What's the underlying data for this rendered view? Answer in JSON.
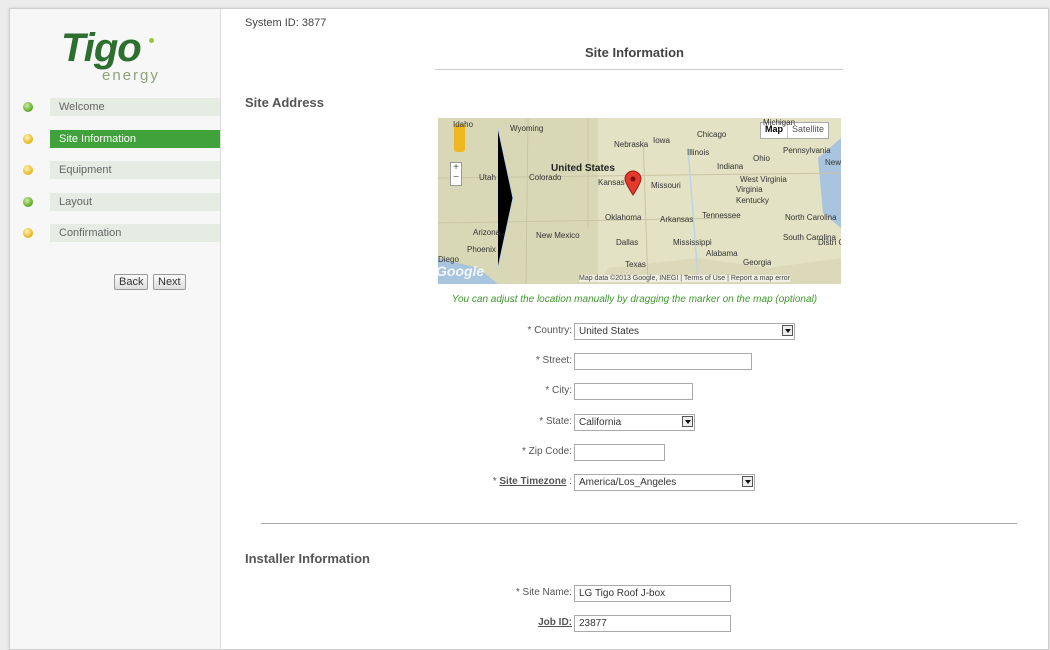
{
  "logo": {
    "brand": "Tigo",
    "sub": "energy"
  },
  "steps": [
    {
      "label": "Welcome",
      "status": "done"
    },
    {
      "label": "Site Information",
      "status": "current"
    },
    {
      "label": "Equipment",
      "status": "pending"
    },
    {
      "label": "Layout",
      "status": "done"
    },
    {
      "label": "Confirmation",
      "status": "pending"
    }
  ],
  "nav": {
    "back": "Back",
    "next": "Next"
  },
  "header": {
    "system_id": "System ID: 3877",
    "title": "Site Information"
  },
  "site_address": {
    "heading": "Site Address",
    "map": {
      "map_tab": "Map",
      "satellite_tab": "Satellite",
      "attribution": "Map data ©2013 Google, INEGI",
      "terms": "Terms of Use",
      "report": "Report a map error",
      "google": "Google",
      "zoom_in": "+",
      "zoom_out": "−",
      "places": [
        "Idaho",
        "Wyoming",
        "Nebraska",
        "Iowa",
        "Chicago",
        "Illinois",
        "Ohio",
        "Pennsylvania",
        "New",
        "Indiana",
        "United States",
        "Utah",
        "Colorado",
        "Kansas",
        "Missouri",
        "West Virginia",
        "Kentucky",
        "Virginia",
        "North Carolina",
        "Tennessee",
        "Oklahoma",
        "Arkansas",
        "Arizona",
        "New Mexico",
        "Dallas",
        "Mississippi",
        "South Carolina",
        "Alabama",
        "Georgia",
        "Texas",
        "Phoenix",
        "Diego",
        "Michigan",
        "Distri Colur"
      ],
      "marker_icon": "map-marker-icon"
    },
    "hint": "You can adjust the location manually by dragging the marker on the map (optional)",
    "country": {
      "label": "* Country:",
      "value": "United States"
    },
    "street": {
      "label": "* Street:",
      "value": ""
    },
    "city": {
      "label": "* City:",
      "value": ""
    },
    "state": {
      "label": "* State:",
      "value": "California"
    },
    "zip": {
      "label": "* Zip Code:",
      "value": ""
    },
    "timezone": {
      "req": "* ",
      "label": "Site Timezone",
      "suffix": " :",
      "value": "America/Los_Angeles"
    }
  },
  "installer": {
    "heading": "Installer Information",
    "site_name": {
      "label": "* Site Name:",
      "value": "LG Tigo Roof J-box"
    },
    "job_id": {
      "label": "Job ID:",
      "value": "23877"
    }
  },
  "colors": {
    "accent": "#3fa23a",
    "hint": "#3d9a2a",
    "brand": "#2d6f2e"
  }
}
